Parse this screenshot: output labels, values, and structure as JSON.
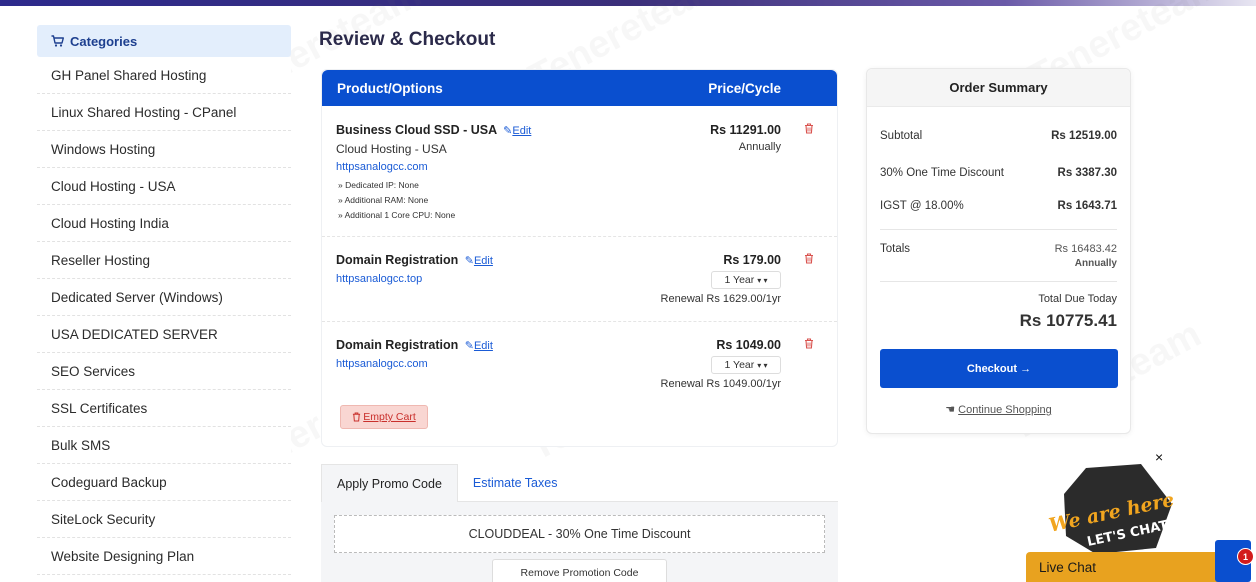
{
  "sidebar": {
    "header": "Categories",
    "items": [
      "GH Panel Shared Hosting",
      "Linux Shared Hosting - CPanel",
      "Windows Hosting",
      "Cloud Hosting - USA",
      "Cloud Hosting India",
      "Reseller Hosting",
      "Dedicated Server (Windows)",
      "USA DEDICATED SERVER",
      "SEO Services",
      "SSL Certificates",
      "Bulk SMS",
      "Codeguard Backup",
      "SiteLock Security",
      "Website Designing Plan"
    ]
  },
  "page": {
    "title": "Review & Checkout"
  },
  "cart": {
    "col_product": "Product/Options",
    "col_price": "Price/Cycle",
    "edit_label": "Edit",
    "items": [
      {
        "name": "Business Cloud SSD - USA",
        "group": "Cloud Hosting - USA",
        "domain": "httpsanalogcc.com",
        "options": [
          "» Dedicated IP: None",
          "» Additional RAM: None",
          "» Additional 1 Core CPU: None"
        ],
        "price": "Rs 11291.00",
        "cycle": "Annually"
      },
      {
        "name": "Domain Registration",
        "domain": "httpsanalogcc.top",
        "price": "Rs 179.00",
        "period": "1 Year",
        "renewal": "Renewal Rs 1629.00/1yr"
      },
      {
        "name": "Domain Registration",
        "domain": "httpsanalogcc.com",
        "price": "Rs 1049.00",
        "period": "1 Year",
        "renewal": "Renewal Rs 1049.00/1yr"
      }
    ],
    "empty_cart": "Empty Cart"
  },
  "promo": {
    "tab_promo": "Apply Promo Code",
    "tab_taxes": "Estimate Taxes",
    "applied": "CLOUDDEAL - 30% One Time Discount",
    "remove": "Remove Promotion Code"
  },
  "summary": {
    "title": "Order Summary",
    "subtotal_label": "Subtotal",
    "subtotal": "Rs 12519.00",
    "discount_label": "30% One Time Discount",
    "discount": "Rs 3387.30",
    "tax_label": "IGST @ 18.00%",
    "tax": "Rs 1643.71",
    "totals_label": "Totals",
    "totals": "Rs 16483.42",
    "totals_cycle": "Annually",
    "due_label": "Total Due Today",
    "due": "Rs 10775.41",
    "checkout": "Checkout →",
    "continue": "Continue Shopping"
  },
  "chat": {
    "bubble_line1": "We are here!",
    "bubble_line2": "LET'S CHAT!",
    "live_chat": "Live Chat",
    "badge": "1",
    "close": "×"
  },
  "watermark": "Tenereteam",
  "colors": {
    "primary": "#0a4fcf",
    "danger": "#d9534f",
    "chat": "#e8a21f"
  }
}
